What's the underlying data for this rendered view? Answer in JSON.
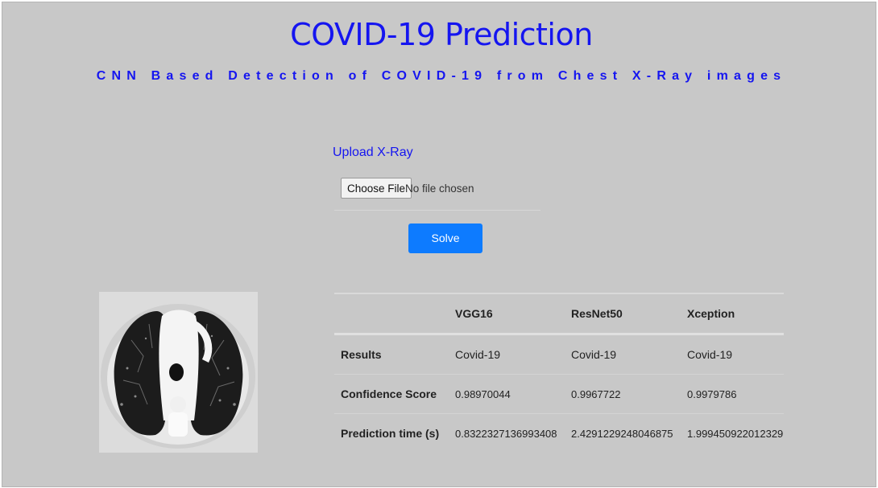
{
  "header": {
    "title": "COVID-19 Prediction",
    "subtitle": "CNN Based Detection of COVID-19 from Chest X-Ray images"
  },
  "upload": {
    "label": "Upload X-Ray",
    "choose_file_label": "Choose File",
    "file_status": "No file chosen",
    "submit_label": "Solve"
  },
  "image": {
    "icon": "chest-xray-ct-scan"
  },
  "results_table": {
    "columns": [
      "",
      "VGG16",
      "ResNet50",
      "Xception"
    ],
    "rows": [
      {
        "label": "Results",
        "values": [
          "Covid-19",
          "Covid-19",
          "Covid-19"
        ]
      },
      {
        "label": "Confidence Score",
        "values": [
          "0.98970044",
          "0.9967722",
          "0.9979786"
        ]
      },
      {
        "label": "Prediction time (s)",
        "values": [
          "0.8322327136993408",
          "2.4291229248046875",
          "1.999450922012329"
        ]
      }
    ]
  },
  "colors": {
    "accent": "#1515f0",
    "button": "#0d7bff",
    "background": "#c8c8c8"
  }
}
